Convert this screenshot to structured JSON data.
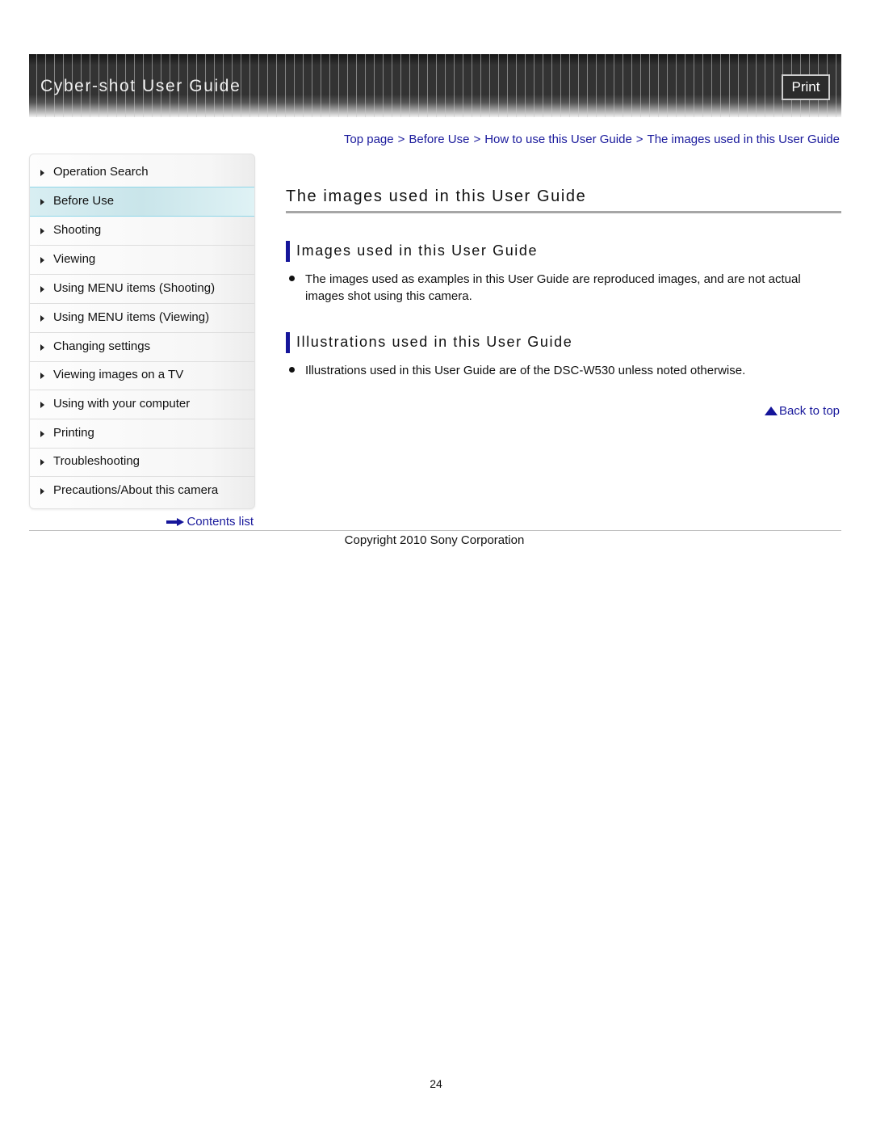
{
  "header": {
    "title": "Cyber-shot User Guide",
    "print_label": "Print"
  },
  "breadcrumb": [
    {
      "label": "Top page"
    },
    {
      "label": "Before Use"
    },
    {
      "label": "How to use this User Guide"
    },
    {
      "label": "The images used in this User Guide"
    }
  ],
  "breadcrumb_separator": ">",
  "sidebar": {
    "items": [
      {
        "label": "Operation Search",
        "icon": "triangle-right-icon",
        "active": false
      },
      {
        "label": "Before Use",
        "icon": "triangle-right-icon",
        "active": true
      },
      {
        "label": "Shooting",
        "icon": "triangle-right-icon",
        "active": false
      },
      {
        "label": "Viewing",
        "icon": "triangle-right-icon",
        "active": false
      },
      {
        "label": "Using MENU items (Shooting)",
        "icon": "triangle-right-icon",
        "active": false
      },
      {
        "label": "Using MENU items (Viewing)",
        "icon": "triangle-right-icon",
        "active": false
      },
      {
        "label": "Changing settings",
        "icon": "triangle-right-icon",
        "active": false
      },
      {
        "label": "Viewing images on a TV",
        "icon": "triangle-right-icon",
        "active": false
      },
      {
        "label": "Using with your computer",
        "icon": "triangle-right-icon",
        "active": false
      },
      {
        "label": "Printing",
        "icon": "triangle-right-icon",
        "active": false
      },
      {
        "label": "Troubleshooting",
        "icon": "triangle-right-icon",
        "active": false
      },
      {
        "label": "Precautions/About this camera",
        "icon": "triangle-right-icon",
        "active": false
      }
    ],
    "contents_link": {
      "label": "Contents list",
      "icon": "arrow-right-icon"
    }
  },
  "main": {
    "title": "The images used in this User Guide",
    "sections": [
      {
        "heading": "Images used in this User Guide",
        "bullets": [
          "The images used as examples in this User Guide are reproduced images, and are not actual images shot using this camera."
        ]
      },
      {
        "heading": "Illustrations used in this User Guide",
        "bullets": [
          "Illustrations used in this User Guide are of the DSC-W530 unless noted otherwise."
        ]
      }
    ],
    "back_to_top": {
      "label": "Back to top",
      "icon": "triangle-up-icon"
    }
  },
  "footer": {
    "copyright": "Copyright 2010 Sony Corporation",
    "page_number": "24"
  },
  "colors": {
    "link": "#1a1a9c",
    "section_bar": "#15159a",
    "header_bg": "#333333",
    "active_nav": "#c9e5ea"
  }
}
